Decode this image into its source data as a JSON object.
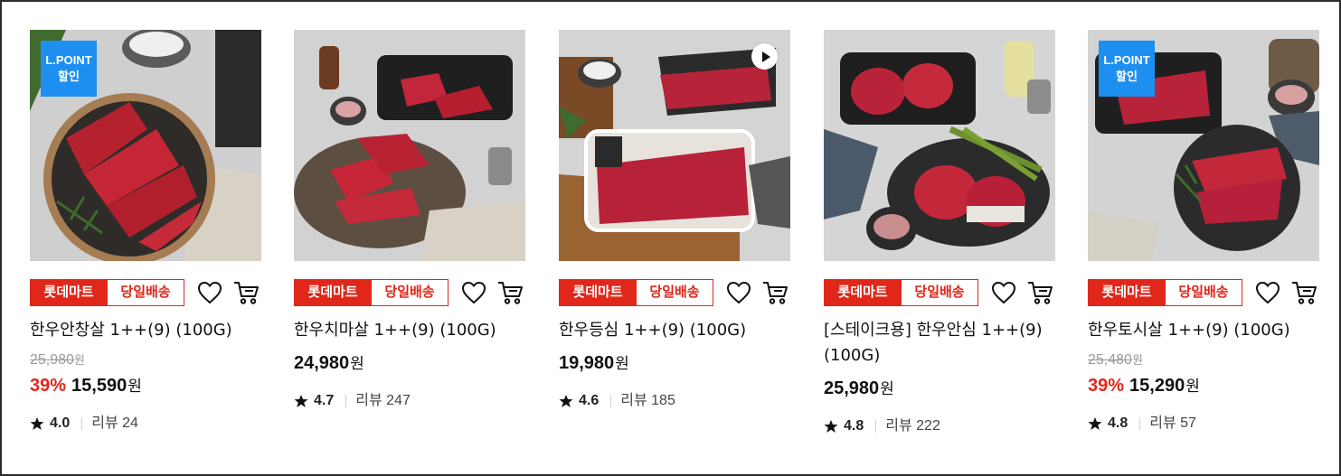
{
  "colors": {
    "accent": "#e0271a",
    "lpoint_blue": "#1d8ff0",
    "text": "#111111",
    "muted": "#9a9a9a"
  },
  "icons": {
    "wishlist": "heart-icon",
    "cart": "cart-icon",
    "rating": "star-icon",
    "video": "play-icon"
  },
  "products": [
    {
      "badge_line1": "L.POINT",
      "badge_line2": "할인",
      "tag_store": "롯데마트",
      "tag_ship": "당일배송",
      "name": "한우안창살 1++(9) (100G)",
      "orig_price": "25,980",
      "orig_unit": "원",
      "discount": "39%",
      "price": "15,590",
      "price_unit": "원",
      "score": "4.0",
      "review_label": "리뷰",
      "review_count": "24"
    },
    {
      "tag_store": "롯데마트",
      "tag_ship": "당일배송",
      "name": "한우치마살 1++(9) (100G)",
      "price": "24,980",
      "price_unit": "원",
      "score": "4.7",
      "review_label": "리뷰",
      "review_count": "247"
    },
    {
      "tag_store": "롯데마트",
      "tag_ship": "당일배송",
      "name": "한우등심 1++(9) (100G)",
      "price": "19,980",
      "price_unit": "원",
      "score": "4.6",
      "review_label": "리뷰",
      "review_count": "185"
    },
    {
      "tag_store": "롯데마트",
      "tag_ship": "당일배송",
      "name": "[스테이크용] 한우안심 1++(9) (100G)",
      "price": "25,980",
      "price_unit": "원",
      "score": "4.8",
      "review_label": "리뷰",
      "review_count": "222"
    },
    {
      "badge_line1": "L.POINT",
      "badge_line2": "할인",
      "tag_store": "롯데마트",
      "tag_ship": "당일배송",
      "name": "한우토시살 1++(9) (100G)",
      "orig_price": "25,480",
      "orig_unit": "원",
      "discount": "39%",
      "price": "15,290",
      "price_unit": "원",
      "score": "4.8",
      "review_label": "리뷰",
      "review_count": "57"
    }
  ]
}
